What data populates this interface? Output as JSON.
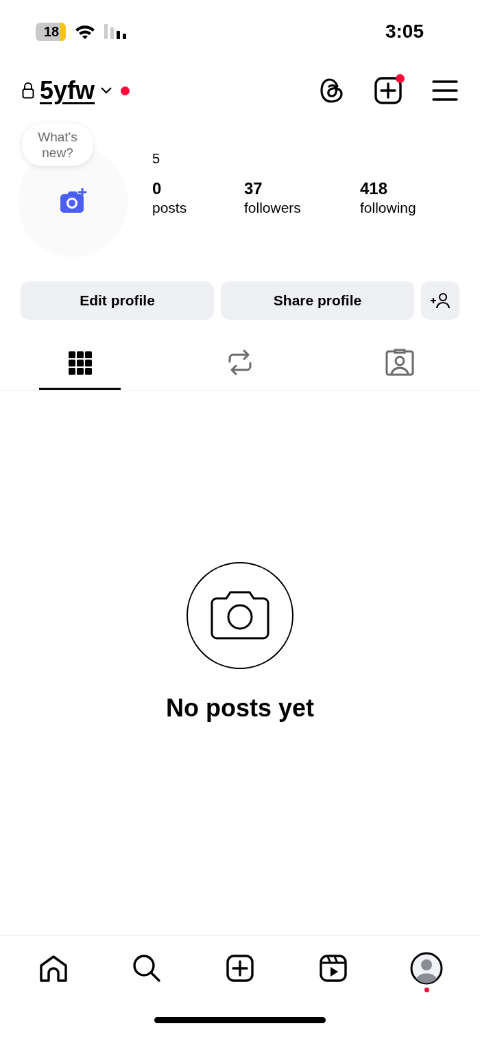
{
  "status_bar": {
    "battery": "18",
    "time": "3:05"
  },
  "header": {
    "username": "5yfw",
    "private": true,
    "username_dot": true,
    "create_dot": true
  },
  "profile": {
    "bubble": "What's new?",
    "name": "5",
    "stats": [
      {
        "value": "0",
        "label": "posts"
      },
      {
        "value": "37",
        "label": "followers"
      },
      {
        "value": "418",
        "label": "following"
      }
    ]
  },
  "buttons": [
    "Edit profile",
    "Share profile"
  ],
  "tabs": [
    {
      "kind": "grid",
      "selected": true
    },
    {
      "kind": "reposts",
      "selected": false
    },
    {
      "kind": "tagged",
      "selected": false
    }
  ],
  "empty_state": {
    "message": "No posts yet"
  },
  "nav": [
    {
      "kind": "home",
      "dot": false
    },
    {
      "kind": "search",
      "dot": false
    },
    {
      "kind": "create",
      "dot": false
    },
    {
      "kind": "reels",
      "dot": false
    },
    {
      "kind": "profile",
      "dot": true
    }
  ]
}
